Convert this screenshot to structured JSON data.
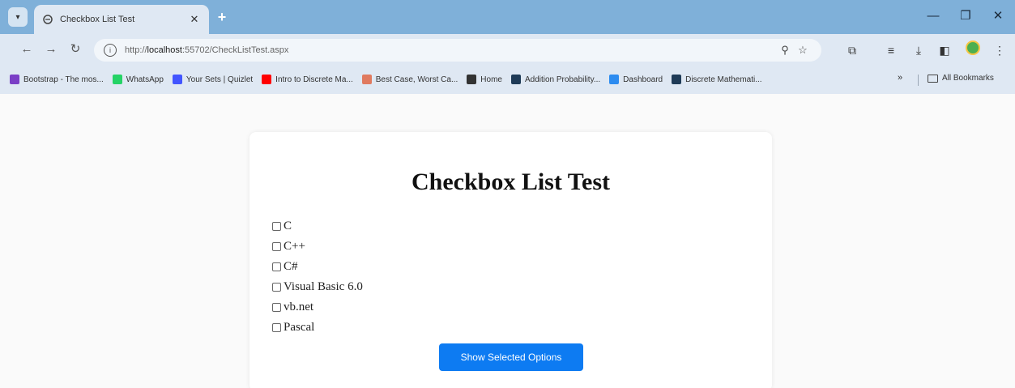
{
  "browser": {
    "tab_title": "Checkbox List Test",
    "tab_close": "✕",
    "new_tab": "+",
    "url_prefix": "http://",
    "url_host": "localhost",
    "url_path": ":55702/CheckListTest.aspx",
    "window": {
      "minimize": "—",
      "restore": "❐",
      "close": "✕"
    }
  },
  "bookmarks": [
    {
      "label": "Bootstrap - The mos...",
      "color": "#7b3fc6"
    },
    {
      "label": "WhatsApp",
      "color": "#25d366"
    },
    {
      "label": "Your Sets | Quizlet",
      "color": "#4255ff"
    },
    {
      "label": "Intro to Discrete Ma...",
      "color": "#ff0000"
    },
    {
      "label": "Best Case, Worst Ca...",
      "color": "#e07a5f"
    },
    {
      "label": "Home",
      "color": "#333333"
    },
    {
      "label": "Addition Probability...",
      "color": "#1f3b57"
    },
    {
      "label": "Dashboard",
      "color": "#2d8cf0"
    },
    {
      "label": "Discrete Mathemati...",
      "color": "#1f3b57"
    }
  ],
  "bookmarks_more": "»",
  "all_bookmarks": "All Bookmarks",
  "page": {
    "title": "Checkbox List Test",
    "options": [
      {
        "label": "C",
        "checked": false
      },
      {
        "label": "C++",
        "checked": false
      },
      {
        "label": "C#",
        "checked": false
      },
      {
        "label": "Visual Basic 6.0",
        "checked": false
      },
      {
        "label": "vb.net",
        "checked": false
      },
      {
        "label": "Pascal",
        "checked": false
      }
    ],
    "button_label": "Show Selected Options"
  },
  "colors": {
    "accent": "#0d7bf2",
    "titlebar": "#7fb0d9",
    "chrome": "#dfe8f3"
  }
}
